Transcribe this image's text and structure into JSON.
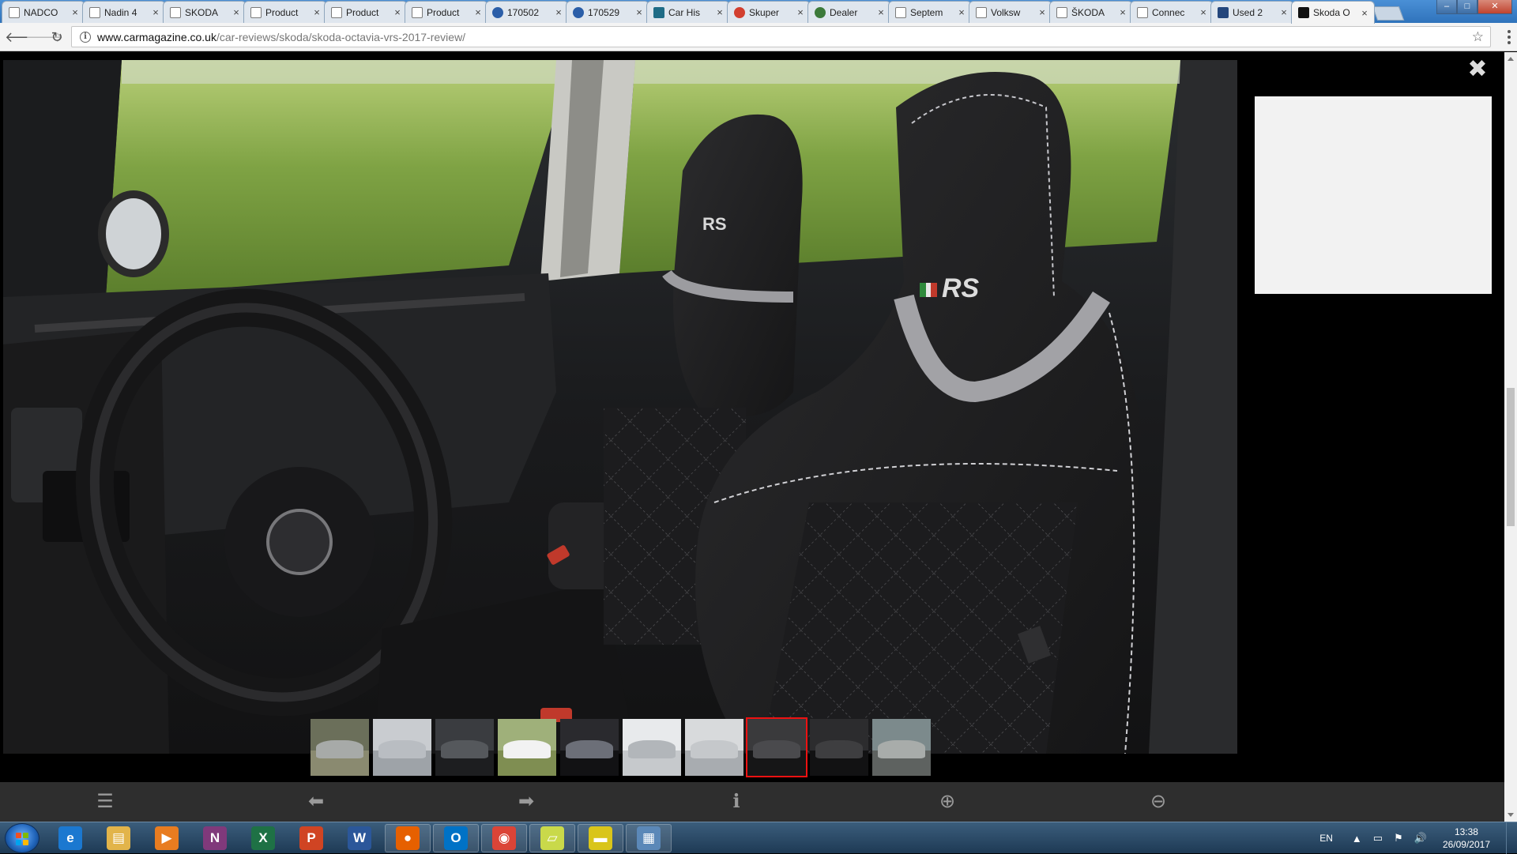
{
  "browser": {
    "tabs": [
      {
        "label": "NADCO",
        "favicon": "doc-icon",
        "style": "doc"
      },
      {
        "label": "Nadin 4",
        "favicon": "doc-icon",
        "style": "doc"
      },
      {
        "label": "SKODA",
        "favicon": "doc-icon",
        "style": "doc"
      },
      {
        "label": "Product",
        "favicon": "doc-icon",
        "style": "doc"
      },
      {
        "label": "Product",
        "favicon": "doc-icon",
        "style": "doc"
      },
      {
        "label": "Product",
        "favicon": "doc-icon",
        "style": "doc"
      },
      {
        "label": "170502",
        "favicon": "vw-logo-icon",
        "style": "blue"
      },
      {
        "label": "170529",
        "favicon": "vw-logo-icon",
        "style": "blue"
      },
      {
        "label": "Car His",
        "favicon": "car-history-icon",
        "style": "teal"
      },
      {
        "label": "Skuper",
        "favicon": "skuper-icon",
        "style": "red"
      },
      {
        "label": "Dealer",
        "favicon": "dealer-icon",
        "style": "green"
      },
      {
        "label": "Septem",
        "favicon": "doc-icon",
        "style": "doc"
      },
      {
        "label": "Volksw",
        "favicon": "doc-icon",
        "style": "doc"
      },
      {
        "label": "ŠKODA",
        "favicon": "doc-icon",
        "style": "doc"
      },
      {
        "label": "Connec",
        "favicon": "doc-icon",
        "style": "doc"
      },
      {
        "label": "Used 2",
        "favicon": "used-cars-icon",
        "style": "navy"
      },
      {
        "label": "Skoda O",
        "favicon": "car-magazine-icon",
        "style": "dark",
        "active": true
      }
    ],
    "window_controls": {
      "minimize": "–",
      "maximize": "□",
      "close": "✕"
    },
    "url": {
      "domain": "www.carmagazine.co.uk",
      "path": "/car-reviews/skoda/skoda-octavia-vrs-2017-review/"
    }
  },
  "lightbox": {
    "close_glyph": "✖",
    "thumbnails": [
      {
        "name": "front-three-quarter-silver",
        "sky": "#6b6f5a",
        "ground": "#8a8a70",
        "car": "#a7aaa8"
      },
      {
        "name": "rear-silver-studio",
        "sky": "#c9ccd0",
        "ground": "#9ea3a8",
        "car": "#b9bdc2"
      },
      {
        "name": "dashboard-interior",
        "sky": "#3a3c40",
        "ground": "#1d1e20",
        "car": "#55585c"
      },
      {
        "name": "white-estate-side",
        "sky": "#9fb07a",
        "ground": "#7f8e52",
        "car": "#f2f2f2"
      },
      {
        "name": "gear-shifter",
        "sky": "#2a2a2e",
        "ground": "#121214",
        "car": "#6c6f78"
      },
      {
        "name": "silver-side-studio",
        "sky": "#e8eaec",
        "ground": "#c6c9cc",
        "car": "#b2b6ba"
      },
      {
        "name": "silver-side-grey",
        "sky": "#d8dadc",
        "ground": "#a8acb0",
        "car": "#c5c8cb"
      },
      {
        "name": "front-seats-vrs",
        "sky": "#3a3a3c",
        "ground": "#161617",
        "car": "#4a4a4d",
        "active": true
      },
      {
        "name": "rear-seats",
        "sky": "#2c2c2e",
        "ground": "#121213",
        "car": "#3e3e40"
      },
      {
        "name": "front-silver-road",
        "sky": "#7c8a8c",
        "ground": "#5e6260",
        "car": "#a8acaa"
      }
    ],
    "controls": [
      {
        "name": "thumbnails-list-button",
        "glyph": "☰"
      },
      {
        "name": "previous-button",
        "glyph": "⬅"
      },
      {
        "name": "next-button",
        "glyph": "➡"
      },
      {
        "name": "info-button",
        "glyph": "ℹ"
      },
      {
        "name": "zoom-in-button",
        "glyph": "⊕"
      },
      {
        "name": "zoom-out-button",
        "glyph": "⊖"
      }
    ],
    "seat_badge": "RS"
  },
  "taskbar": {
    "apps": [
      {
        "name": "internet-explorer",
        "glyph": "e",
        "color": "#1b78d0"
      },
      {
        "name": "file-explorer",
        "glyph": "▤",
        "color": "#e2b44a"
      },
      {
        "name": "media-player",
        "glyph": "▶",
        "color": "#e87c20"
      },
      {
        "name": "onenote",
        "glyph": "N",
        "color": "#80397b"
      },
      {
        "name": "excel",
        "glyph": "X",
        "color": "#1e7145"
      },
      {
        "name": "powerpoint",
        "glyph": "P",
        "color": "#d04423"
      },
      {
        "name": "word",
        "glyph": "W",
        "color": "#2b579a"
      },
      {
        "name": "firefox",
        "glyph": "●",
        "color": "#e66000"
      },
      {
        "name": "outlook",
        "glyph": "O",
        "color": "#0072c6"
      },
      {
        "name": "chrome",
        "glyph": "◉",
        "color": "#db4437"
      },
      {
        "name": "sticky-notes",
        "glyph": "▱",
        "color": "#c9d94a"
      },
      {
        "name": "terminal",
        "glyph": "▬",
        "color": "#d9c51a"
      },
      {
        "name": "calculator",
        "glyph": "▦",
        "color": "#5b88b8"
      }
    ],
    "tray": {
      "language": "EN",
      "time": "13:38",
      "date": "26/09/2017"
    }
  }
}
